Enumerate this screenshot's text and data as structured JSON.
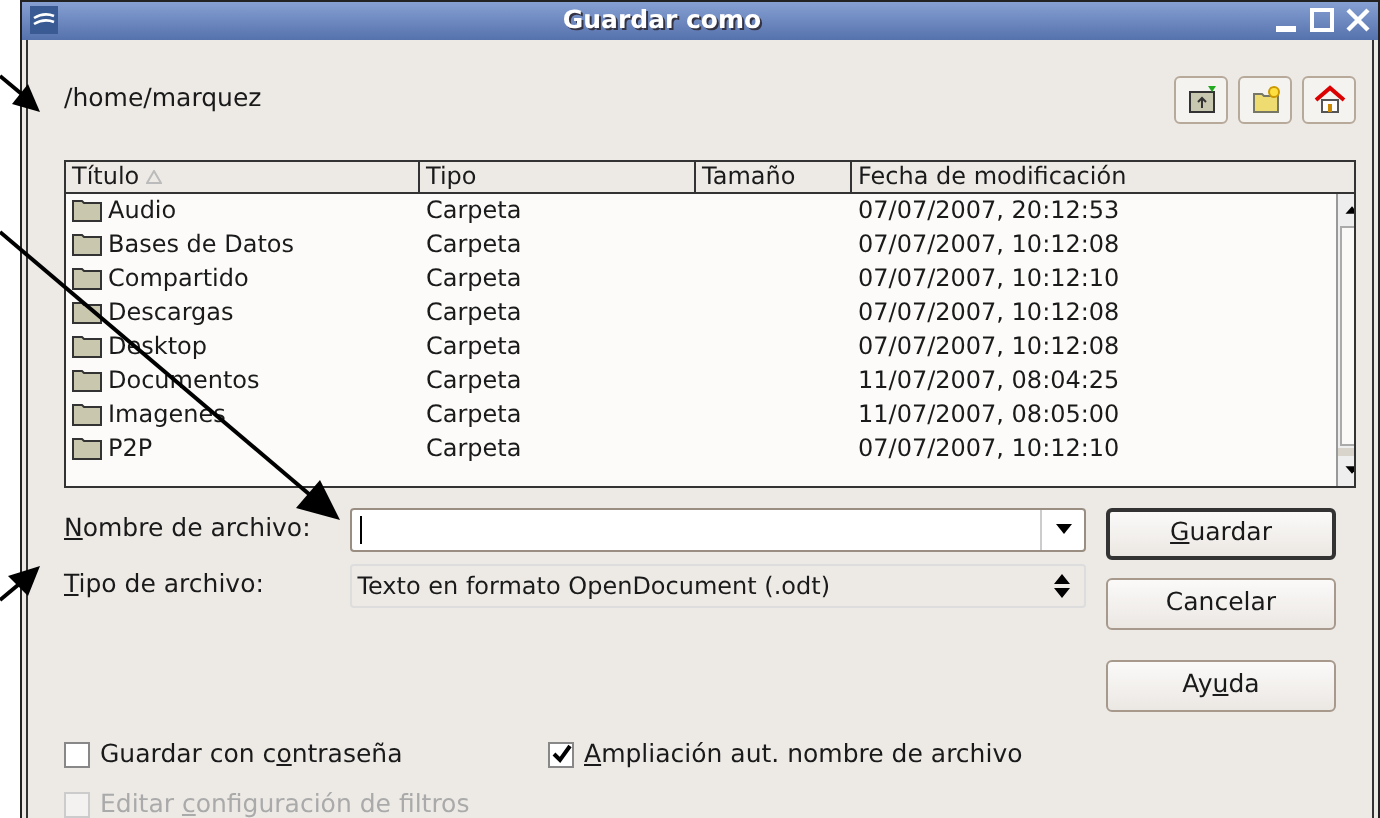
{
  "window": {
    "title": "Guardar como"
  },
  "path": "/home/marquez",
  "toolbar": [
    {
      "kind": "up"
    },
    {
      "kind": "new-folder"
    },
    {
      "kind": "home"
    }
  ],
  "table": {
    "columns": [
      {
        "label": "Título",
        "sorted": true
      },
      {
        "label": "Tipo",
        "sorted": false
      },
      {
        "label": "Tamaño",
        "sorted": false
      },
      {
        "label": "Fecha de modificación",
        "sorted": false
      }
    ],
    "rows": [
      {
        "title": "Audio",
        "type": "Carpeta",
        "modified": "07/07/2007, 20:12:53"
      },
      {
        "title": "Bases de Datos",
        "type": "Carpeta",
        "modified": "07/07/2007, 10:12:08"
      },
      {
        "title": "Compartido",
        "type": "Carpeta",
        "modified": "07/07/2007, 10:12:10"
      },
      {
        "title": "Descargas",
        "type": "Carpeta",
        "modified": "07/07/2007, 10:12:08"
      },
      {
        "title": "Desktop",
        "type": "Carpeta",
        "modified": "07/07/2007, 10:12:08"
      },
      {
        "title": "Documentos",
        "type": "Carpeta",
        "modified": "11/07/2007, 08:04:25"
      },
      {
        "title": "Imagenes",
        "type": "Carpeta",
        "modified": "11/07/2007, 08:05:00"
      },
      {
        "title": "P2P",
        "type": "Carpeta",
        "modified": "07/07/2007, 10:12:10"
      }
    ]
  },
  "fields": [
    {
      "kind": "combo",
      "label": {
        "key": "N",
        "post": "ombre de archivo:"
      }
    },
    {
      "kind": "spin",
      "label": {
        "key": "T",
        "post": "ipo de archivo:"
      },
      "value": "Texto en formato OpenDocument (.odt)"
    }
  ],
  "buttons": [
    {
      "label": {
        "key": "G",
        "post": "uardar"
      },
      "default": true
    },
    {
      "label": {
        "pre": "Cancelar"
      },
      "default": false
    },
    {
      "label": {
        "pre": "Ay",
        "key": "u",
        "post": "da"
      },
      "default": false
    }
  ],
  "options": [
    {
      "label": {
        "pre": "Guardar con c",
        "key": "o",
        "post": "ntraseña"
      },
      "checked": false,
      "disabled": false
    },
    {
      "label": {
        "key": "A",
        "post": "mpliación aut. nombre de archivo"
      },
      "checked": true,
      "disabled": false
    },
    {
      "label": {
        "pre": "Editar ",
        "key": "c",
        "post": "onfiguración de filtros"
      },
      "checked": false,
      "disabled": true
    }
  ]
}
